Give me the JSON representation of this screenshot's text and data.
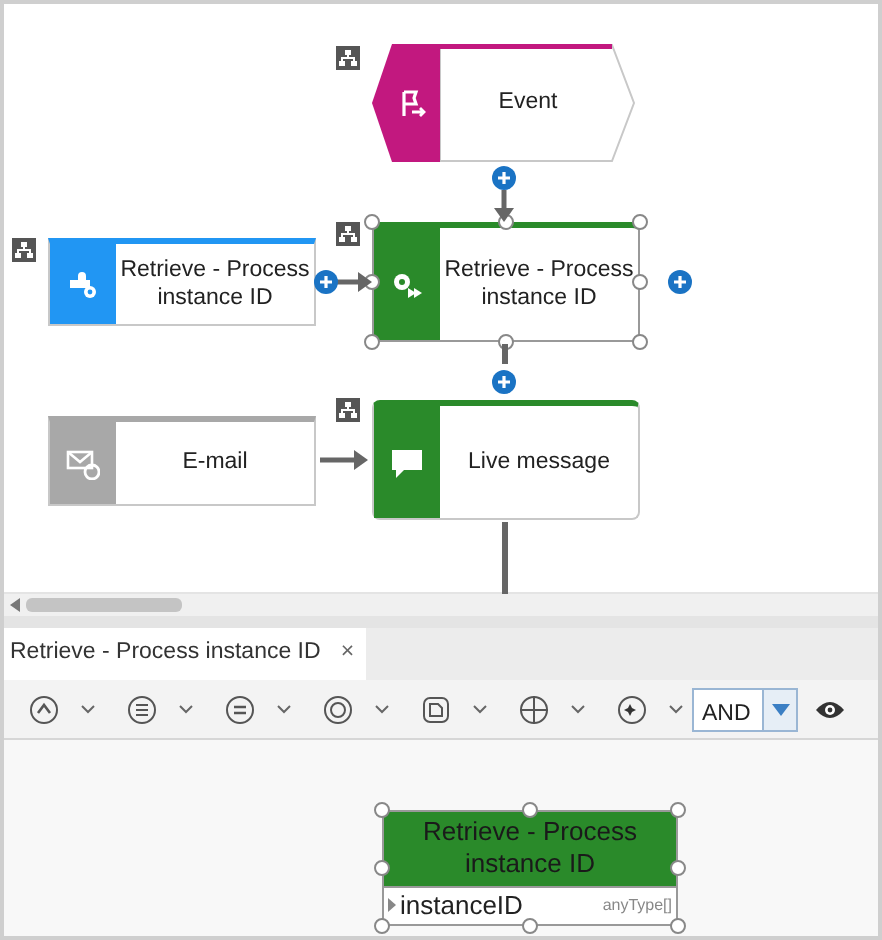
{
  "diagram": {
    "nodes": [
      {
        "kind": "event",
        "label": "Event",
        "color": "#c2187f",
        "selected": false,
        "assigned": true
      },
      {
        "kind": "service",
        "label": "Retrieve - Process instance ID",
        "color": "#2196f3",
        "selected": false,
        "assigned": true
      },
      {
        "kind": "function",
        "label": "Retrieve - Process instance ID",
        "color": "#2a8a2a",
        "selected": true,
        "assigned": true
      },
      {
        "kind": "email",
        "label": "E-mail",
        "color": "#a8a8a8",
        "selected": false,
        "assigned": false
      },
      {
        "kind": "message",
        "label": "Live message",
        "color": "#2a8a2a",
        "selected": false,
        "assigned": true
      }
    ]
  },
  "editor": {
    "tabs": [
      {
        "label": "Retrieve - Process instance ID",
        "selected": true,
        "close_label": "×"
      }
    ],
    "toolbar": {
      "operator": "AND"
    },
    "mapping_node": {
      "title": "Retrieve - Process instance ID",
      "color": "#2a8a2a",
      "selected": true,
      "attributes": [
        {
          "name": "instanceID",
          "type": "anyType[]"
        }
      ]
    }
  }
}
